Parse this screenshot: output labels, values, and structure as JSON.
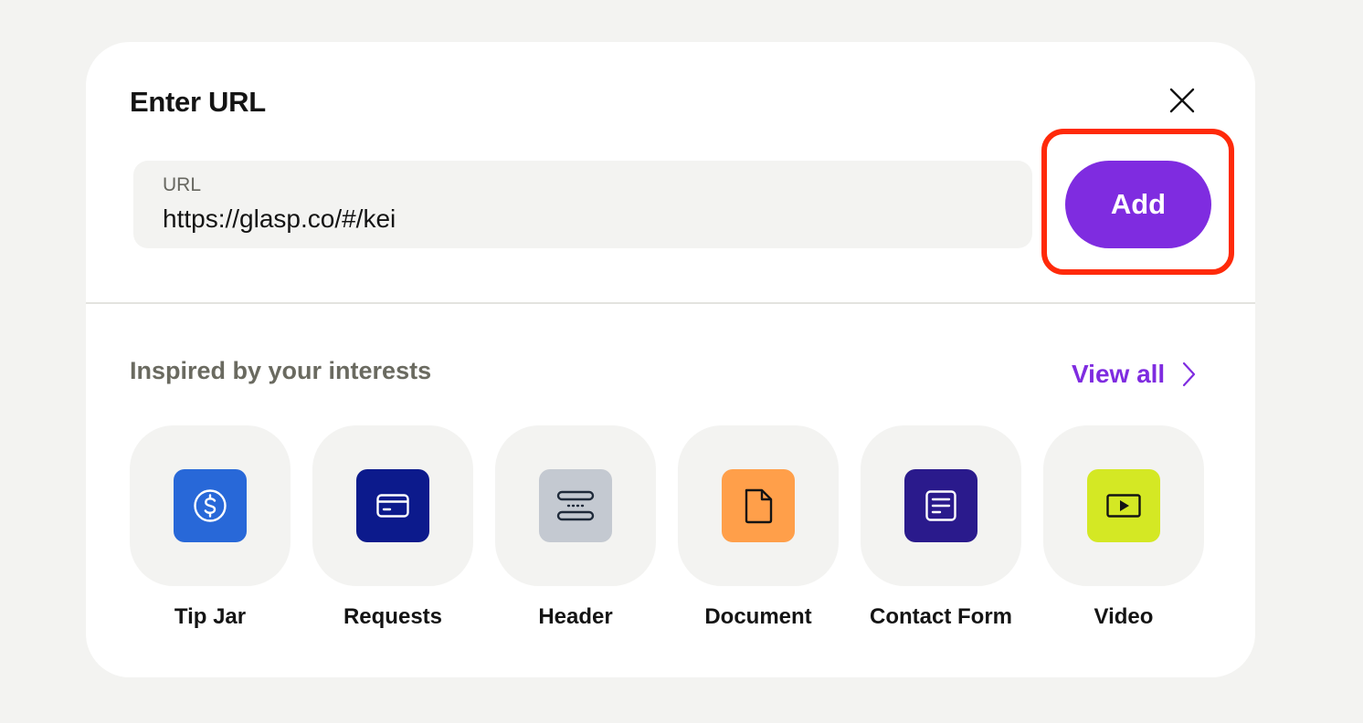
{
  "dialog": {
    "title": "Enter URL",
    "close_icon": "close-icon"
  },
  "url_input": {
    "label": "URL",
    "value": "https://glasp.co/#/kei"
  },
  "add_button": {
    "label": "Add"
  },
  "colors": {
    "accent": "#7f2ce0",
    "highlight": "#ff2a0a",
    "background": "#f3f3f1"
  },
  "suggestions": {
    "title": "Inspired by your interests",
    "view_all": "View all",
    "items": [
      {
        "label": "Tip Jar",
        "icon": "dollar-coin-icon",
        "color": "#2868d8"
      },
      {
        "label": "Requests",
        "icon": "credit-card-icon",
        "color": "#0c1a8c"
      },
      {
        "label": "Header",
        "icon": "header-icon",
        "color": "#c4c9d1"
      },
      {
        "label": "Document",
        "icon": "document-icon",
        "color": "#ff9f4a"
      },
      {
        "label": "Contact Form",
        "icon": "form-icon",
        "color": "#2a1a8c"
      },
      {
        "label": "Video",
        "icon": "video-icon",
        "color": "#d4e824"
      }
    ]
  }
}
